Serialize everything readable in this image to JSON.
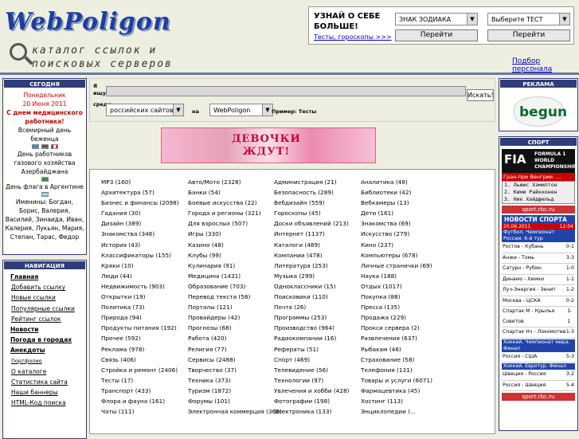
{
  "logo": {
    "title": "WebPoligon",
    "tagline1": "каталог ссылок и",
    "tagline2": "поисковых серверов"
  },
  "topbox": {
    "question": "УЗНАЙ О СЕБЕ БОЛЬШЕ!",
    "zodiac": "ЗНАК ЗОДИАКА",
    "test": "Выберите ТЕСТ",
    "go1": "Перейти",
    "go2": "Перейти",
    "link": "Тесты, гороскопы >>>"
  },
  "podbor": "Подбор персонала",
  "today": {
    "title": "СЕГОДНЯ",
    "day": "Понедельник",
    "date": "20 Июня 2011",
    "holiday": "С днем медицинского работника!",
    "lines": [
      "Всемирный день беженца",
      "День работников газового хозяйства Азербайджана",
      "День флага в Аргентине"
    ],
    "names": "Именины: Богдан, Борис, Валерия, Василий, Зинаида, Иван, Калерия, Лукьян, Мария, Степан, Тарас, Федор"
  },
  "nav": {
    "title": "НАВИГАЦИЯ",
    "items": [
      {
        "label": "Главная",
        "bold": true
      },
      {
        "label": "Добавить ссылку",
        "bold": false
      },
      {
        "label": "Новые ссылки",
        "bold": false
      },
      {
        "label": "Популярные ссылки",
        "bold": false
      },
      {
        "label": "Рейтинг ссылок",
        "bold": false
      },
      {
        "label": "Новости",
        "bold": true
      },
      {
        "label": "Погода в городах",
        "bold": true
      },
      {
        "label": "Анекдоты",
        "bold": true
      },
      {
        "label": "Портфолио",
        "bold": false,
        "small": true
      },
      {
        "label": "О каталоге",
        "bold": false
      },
      {
        "label": "Статистика сайта",
        "bold": false
      },
      {
        "label": "Наши баннеры",
        "bold": false
      },
      {
        "label": "HTML-Код поиска",
        "bold": false
      }
    ]
  },
  "search": {
    "label_find": "Я ищу",
    "label_among": "среди",
    "scope": "российских сайтов",
    "label_on": "на",
    "engine": "WebPoligon",
    "button": "Искать!",
    "example": "Пример: Тесты"
  },
  "banner": {
    "text1": "ДЕВОЧКИ",
    "text2": "ЖДУТ!"
  },
  "categories": [
    "MP3 (160)",
    "Авто/Мото (2328)",
    "Администрация (21)",
    "Аналитика (48)",
    "Архитектура (57)",
    "Банки (54)",
    "Безопасность (289)",
    "Библиотеки (42)",
    "Бизнес и финансы (2098)",
    "Боевые искусства (22)",
    "Вебдизайн (559)",
    "Вебкамеры (13)",
    "Гадания (30)",
    "Города и регионы (321)",
    "Гороскопы (45)",
    "Дети (161)",
    "Дизайн (389)",
    "Для взрослых (507)",
    "Доски объявлений (213)",
    "Знакомства (69)",
    "Знакомства (346)",
    "Игры (330)",
    "Интернет (1137)",
    "Искусство (279)",
    "История (43)",
    "Казино (48)",
    "Каталоги (489)",
    "Кино (237)",
    "Классификаторы (155)",
    "Клубы (99)",
    "Компании (478)",
    "Компьютеры (678)",
    "Кряки (10)",
    "Кулинария (91)",
    "Литература (253)",
    "Личные странички (69)",
    "Люди (44)",
    "Медицина (1431)",
    "Музыка (299)",
    "Наука (188)",
    "Недвижимость (903)",
    "Образование (703)",
    "Одноклассники (15)",
    "Отдых (1017)",
    "Открытки (19)",
    "Перевод текста (58)",
    "Поисковики (110)",
    "Покупка (88)",
    "Политика (73)",
    "Порталы (121)",
    "Почта (26)",
    "Пресса (135)",
    "Природа (94)",
    "Провайдеры (42)",
    "Программы (253)",
    "Продажа (229)",
    "Продукты питания (192)",
    "Прогнозы (68)",
    "Производство (964)",
    "Прокси сервера (2)",
    "Прочее (592)",
    "Работа (420)",
    "Радиокомпании (16)",
    "Развлечения (637)",
    "Реклама (978)",
    "Религия (77)",
    "Рефераты (51)",
    "Рыбакам (46)",
    "Связь (406)",
    "Сервисы (2488)",
    "Спорт (469)",
    "Страхование (58)",
    "Стройка и ремонт (2406)",
    "Творчество (37)",
    "Телевидение (56)",
    "Телефония (131)",
    "Тесты (17)",
    "Техника (373)",
    "Технологии (97)",
    "Товары и услуги (6071)",
    "Транспорт (433)",
    "Туризм (1872)",
    "Увлечения и хобби (428)",
    "Фармацевтика (45)",
    "Флора и фауна (161)",
    "Форумы (101)",
    "Фотографии (198)",
    "Хостинг (113)",
    "Чаты (111)",
    "Электронная коммерция (360)",
    "Электроника (133)",
    "Энциклопедии (..."
  ],
  "ads": {
    "title": "РЕКЛАМА",
    "brand": "begun"
  },
  "sport": {
    "title": "СПОРТ",
    "f1": "FIA",
    "f1_sub": [
      "FORMULA 1",
      "WORLD",
      "CHAMPIONSHIP"
    ],
    "gp": "Гран-при Венгрии. ...",
    "results": [
      "1. Льюис Хэмилтон",
      "2. Кими Райкконен",
      "3. Ник Хайдфельд"
    ],
    "source": "sport.rbc.ru",
    "news": "НОВОСТИ СПОРТА",
    "news_date": "20.06.2011",
    "news_time": "12:04",
    "news_head": "Футбол. Чемпионат России. 6-й тур",
    "matches": [
      [
        "Ростов - Кубань",
        "0-1"
      ],
      [
        "Анжи - Томь",
        "3-3"
      ],
      [
        "Сатурн - Рубин",
        "1-0"
      ],
      [
        "Динамо - Химки",
        "1-1"
      ],
      [
        "Луч-Энергия - Зенит",
        "1-2"
      ],
      [
        "Москва - ЦСКА",
        "0-2"
      ],
      [
        "Спартак М - Крылья Советов",
        "1-1"
      ],
      [
        "Спартак Нч - Локомотив",
        "1-3"
      ]
    ],
    "hockey1": "Хоккей. Чемпионат мира. Финал",
    "hockey1_m": [
      [
        "Россия - США",
        "5-3"
      ]
    ],
    "hockey2": "Хоккей. Евротур. Финал",
    "hockey2_m": [
      [
        "Швеция - Россия",
        "3-2"
      ],
      [
        "Россия - Швеция",
        "5-4"
      ]
    ],
    "source2": "sport.rbc.ru"
  }
}
